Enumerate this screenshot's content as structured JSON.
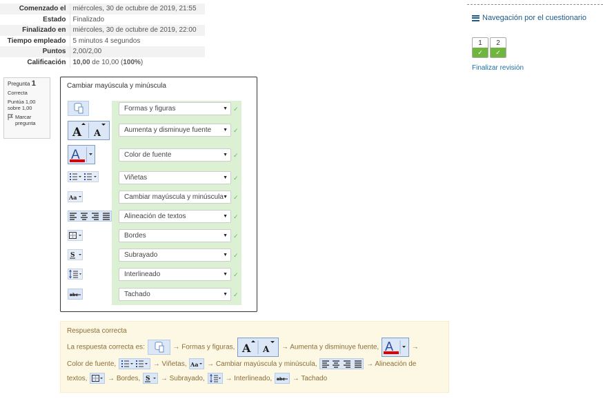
{
  "summary": {
    "rows": [
      {
        "label": "Comenzado el",
        "value": "miércoles, 30 de octubre de 2019, 21:55"
      },
      {
        "label": "Estado",
        "value": "Finalizado"
      },
      {
        "label": "Finalizado en",
        "value": "miércoles, 30 de octubre de 2019, 22:00"
      },
      {
        "label": "Tiempo empleado",
        "value": "5 minutos 4 segundos"
      },
      {
        "label": "Puntos",
        "value": "2,00/2,00"
      }
    ],
    "grade_label": "Calificación",
    "grade_bold": "10,00",
    "grade_mid": " de 10,00 (",
    "grade_pct": "100%",
    "grade_end": ")"
  },
  "question_info": {
    "prefix": "Pregunta",
    "number": "1",
    "state": "Correcta",
    "score": "Puntúa 1,00 sobre 1,00",
    "flag_label": "Marcar pregunta"
  },
  "question": {
    "text": "Cambiar mayúscula y minúscula",
    "rows": [
      {
        "icon": "shapes-icon",
        "selected": "Formas y figuras"
      },
      {
        "icon": "font-size-icon",
        "selected": "Aumenta y disminuye fuente"
      },
      {
        "icon": "font-color-icon",
        "selected": "Color de fuente"
      },
      {
        "icon": "bullets-icon",
        "selected": "Viñetas"
      },
      {
        "icon": "change-case-icon",
        "selected": "Cambiar mayúscula y minúscula"
      },
      {
        "icon": "text-align-icon",
        "selected": "Alineación de textos"
      },
      {
        "icon": "borders-icon",
        "selected": "Bordes"
      },
      {
        "icon": "underline-icon",
        "selected": "Subrayado"
      },
      {
        "icon": "line-spacing-icon",
        "selected": "Interlineado"
      },
      {
        "icon": "strikethrough-icon",
        "selected": "Tachado"
      }
    ]
  },
  "feedback": {
    "title": "Respuesta correcta",
    "intro": "La respuesta correcta es:",
    "arrow": "→",
    "items": [
      "Formas y figuras,",
      "Aumenta y disminuye fuente,",
      "Color de fuente,",
      "Viñetas,",
      "Cambiar mayúscula y minúscula,",
      "Alineación de",
      "textos,",
      "Bordes,",
      "Subrayado,",
      "Interlineado,",
      "Tachado"
    ]
  },
  "nav": {
    "title": "Navegación por el cuestionario",
    "buttons": [
      "1",
      "2"
    ],
    "finish": "Finalizar revisión"
  },
  "colors": {
    "correct_bg": "#dcf0d3",
    "check": "#5cb85c",
    "feedback_bg": "#fcf8e3",
    "feedback_text": "#8a6d3b",
    "link": "#1d6fa5",
    "nav_correct": "#6fb63f"
  }
}
